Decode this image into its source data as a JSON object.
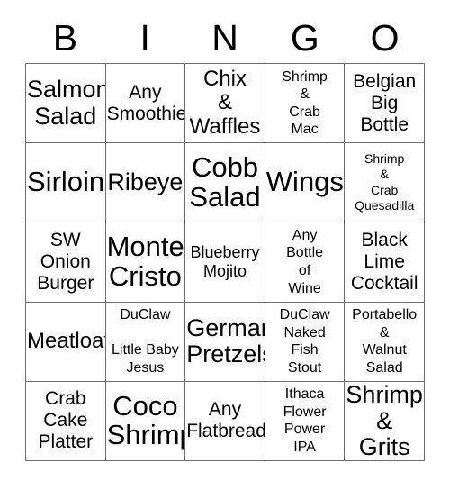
{
  "card": {
    "title": "BINGO",
    "header_letters": [
      "B",
      "I",
      "N",
      "G",
      "O"
    ],
    "columns": 5,
    "rows": 5,
    "border_color": "#6f6f6f",
    "text_color": "#000000",
    "background_color": "#ffffff"
  },
  "cells": [
    {
      "text": "Salmon\nSalad",
      "size": "xl"
    },
    {
      "text": "Any\nSmoothie",
      "size": "md"
    },
    {
      "text": "Chix\n&\nWaffles",
      "size": "lg"
    },
    {
      "text": "Shrimp\n&\nCrab\nMac",
      "size": "xs"
    },
    {
      "text": "Belgian\nBig\nBottle",
      "size": "md"
    },
    {
      "text": "Sirloin",
      "size": "xxl"
    },
    {
      "text": "Ribeye",
      "size": "xl"
    },
    {
      "text": "Cobb\nSalad",
      "size": "xxl"
    },
    {
      "text": "Wings",
      "size": "xxl"
    },
    {
      "text": "Shrimp\n&\nCrab\nQuesadilla",
      "size": "xxs"
    },
    {
      "text": "SW\nOnion\nBurger",
      "size": "md"
    },
    {
      "text": "Monte\nCristo",
      "size": "xxl"
    },
    {
      "text": "Blueberry\nMojito",
      "size": "sm"
    },
    {
      "text": "Any\nBottle\nof\nWine",
      "size": "xs"
    },
    {
      "text": "Black\nLime\nCocktail",
      "size": "md"
    },
    {
      "text": "Meatloaf",
      "size": "lg"
    },
    {
      "text": "DuClaw\n\nLittle Baby\nJesus",
      "size": "xs"
    },
    {
      "text": "German\nPretzels",
      "size": "xl"
    },
    {
      "text": "DuClaw\nNaked\nFish\nStout",
      "size": "xs"
    },
    {
      "text": "Portabello\n&\nWalnut\nSalad",
      "size": "xs"
    },
    {
      "text": "Crab\nCake\nPlatter",
      "size": "md"
    },
    {
      "text": "Coco\nShrimp",
      "size": "xxl"
    },
    {
      "text": "Any\nFlatbread",
      "size": "md"
    },
    {
      "text": "Ithaca\nFlower\nPower\nIPA",
      "size": "xs"
    },
    {
      "text": "Shrimp\n&\nGrits",
      "size": "xl"
    }
  ]
}
